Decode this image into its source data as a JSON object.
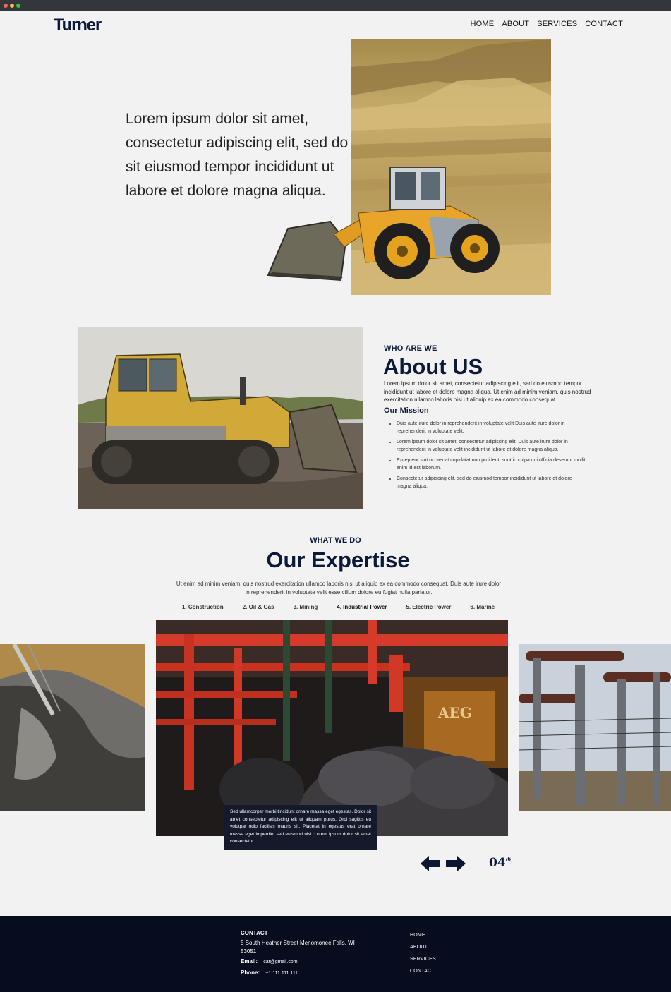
{
  "brand": {
    "logo": "Turner"
  },
  "nav": {
    "items": [
      "HOME",
      "ABOUT",
      "SERVICES",
      "CONTACT"
    ]
  },
  "hero": {
    "text": "Lorem ipsum dolor sit amet, consectetur adipiscing elit, sed do sit eiusmod tempor incididunt ut labore et dolore magna aliqua."
  },
  "about": {
    "eyebrow": "WHO ARE WE",
    "title": "About US",
    "body": "Lorem ipsum dolor sit amet, consectetur adipiscing elit, sed do eiusmod tempor incididunt ut labore et dolore magna aliqua. Ut enim ad minim veniam, quis nostrud exercitation ullamco laboris nisi ut aliquip ex ea commodo consequat.",
    "mission_title": "Our Mission",
    "mission": [
      "Duis aute irure dolor in reprehenderit in voluptate velit Duis aute irure dolor in reprehenderit in voluptate velit.",
      "Lorem ipsum dolor sit amet, consectetur adipiscing elit, Duis aute irure dolor in reprehenderit in voluptate velit incididunt ut labore et dolore magna aliqua.",
      "Excepteur sint occaecat cupidatat non proident, sunt in culpa qui officia deserunt mollit anim id est laborum.",
      "Consectetur adipiscing elit, sed do eiusmod tempor incididunt ut labore et dolore magna aliqua."
    ]
  },
  "expertise": {
    "eyebrow": "WHAT WE DO",
    "title": "Our Expertise",
    "body": "Ut enim ad minim veniam, quis nostrud exercitation ullamco laboris nisi ut aliquip ex ea commodo consequat. Duis aute irure dolor in reprehenderit in voluptate velit esse cillum dolore eu fugiat nulla pariatur.",
    "tabs": [
      "1. Construction",
      "2. Oil & Gas",
      "3. Mining",
      "4. Industrial Power",
      "5. Electric Power",
      "6. Marine"
    ],
    "active_tab": 3,
    "caption": "Sed ullamcorper morbi tincidunt ornare massa eget egestas. Dolor sit amet consectetur adipiscing elit ut aliquam purus. Orci sagittis eu volutpat odio facilisis mauris sit. Placerat in egestas erat ornare massa eget imperdiet sed euismod nisi. Lorem ipsum dolor sit amet consectetur.",
    "slide_current": "04",
    "slide_total": "6",
    "machine_text": "AEG"
  },
  "footer": {
    "contact_heading": "CONTACT",
    "address": "5 South Heather Street Menomonee Falls, WI 53051",
    "email_label": "Email:",
    "email": "cat@gmail.com",
    "phone_label": "Phone:",
    "phone": "+1 111 111 111",
    "nav": [
      "HOME",
      "ABOUT",
      "SERVICES",
      "CONTACT"
    ]
  },
  "colors": {
    "navy": "#0b1a3c",
    "footer_bg": "#070c1e",
    "background": "#f2f2f2"
  }
}
